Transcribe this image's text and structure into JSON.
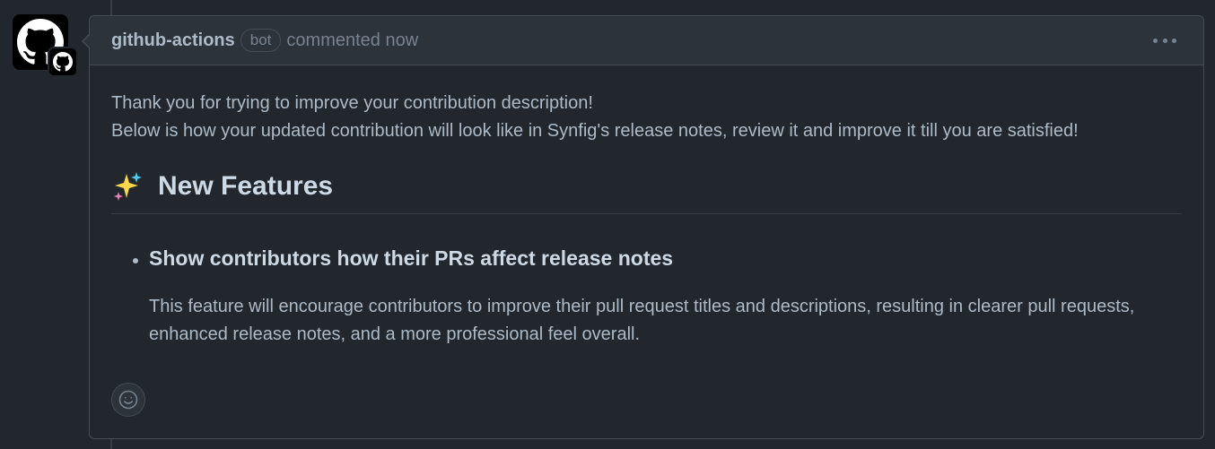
{
  "comment": {
    "author": "github-actions",
    "badge": "bot",
    "meta": "commented now",
    "body": {
      "line1": "Thank you for trying to improve your contribution description!",
      "line2": "Below is how your updated contribution will look like in Synfig's release notes, review it and improve it till you are satisfied!",
      "heading": "New Features",
      "feature_title": "Show contributors how their PRs affect release notes",
      "feature_desc": "This feature will encourage contributors to improve their pull request titles and descriptions, resulting in clearer pull requests, enhanced release notes, and a more professional feel overall."
    }
  },
  "icons": {
    "avatar": "github-mark-icon",
    "badge": "github-app-icon",
    "menu": "kebab-horizontal-icon",
    "heading": "sparkles-icon",
    "reaction": "smiley-icon"
  },
  "colors": {
    "background": "#22272e",
    "header": "#2d333b",
    "border": "#444c56",
    "text": "#adbac7",
    "muted": "#768390",
    "heading": "#cdd9e5"
  }
}
